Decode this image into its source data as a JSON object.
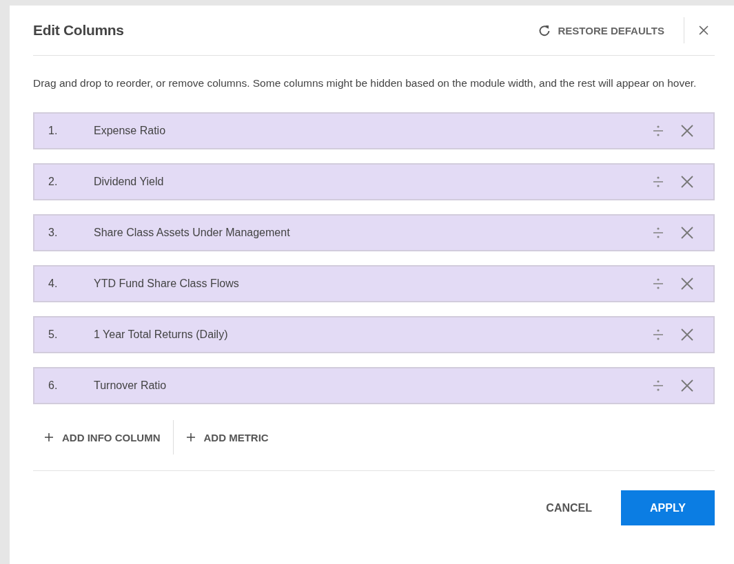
{
  "dialog": {
    "title": "Edit Columns",
    "restore_button": "RESTORE DEFAULTS",
    "description": "Drag and drop to reorder, or remove columns. Some columns might be hidden based on the module width, and the rest will appear on hover.",
    "columns": [
      {
        "number": "1.",
        "name": "Expense Ratio"
      },
      {
        "number": "2.",
        "name": "Dividend Yield"
      },
      {
        "number": "3.",
        "name": "Share Class Assets Under Management"
      },
      {
        "number": "4.",
        "name": "YTD Fund Share Class Flows"
      },
      {
        "number": "5.",
        "name": "1 Year Total Returns (Daily)"
      },
      {
        "number": "6.",
        "name": "Turnover Ratio"
      }
    ],
    "add_buttons": [
      "ADD INFO COLUMN",
      "ADD METRIC"
    ],
    "cancel_button": "CANCEL",
    "apply_button": "APPLY"
  }
}
